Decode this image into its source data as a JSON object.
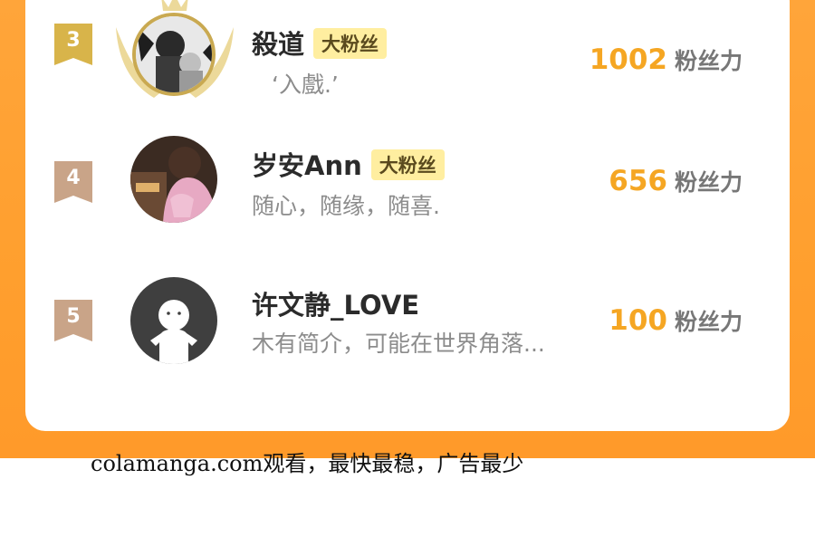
{
  "ranking": [
    {
      "rank": "3",
      "name": "殺道",
      "badge": "大粉丝",
      "bio": "‘入戲.’",
      "score": "1002",
      "unit": "粉丝力"
    },
    {
      "rank": "4",
      "name": "岁安Ann",
      "badge": "大粉丝",
      "bio": "随心，随缘，随喜.",
      "score": "656",
      "unit": "粉丝力"
    },
    {
      "rank": "5",
      "name": "许文静_LOVE",
      "badge": "",
      "bio": "木有简介，可能在世界角落...",
      "score": "100",
      "unit": "粉丝力"
    }
  ],
  "footer": {
    "text": "colamanga.com观看，最快最稳，广告最少"
  },
  "colors": {
    "orange": "#ffa33a",
    "gold_rank": "#d8b44a",
    "bronze_rank": "#c9a488",
    "score": "#f5a623",
    "badge_bg": "#ffeea0"
  }
}
